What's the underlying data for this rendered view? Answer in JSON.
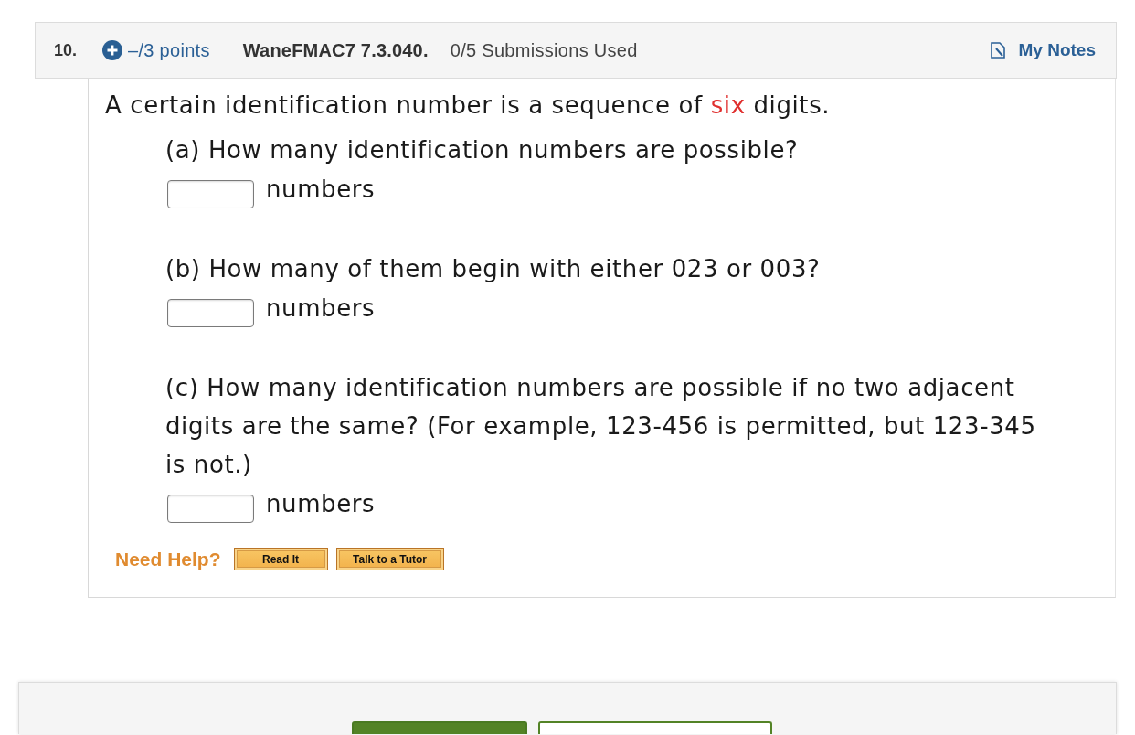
{
  "question": {
    "number": "10.",
    "points": "–/3 points",
    "source": "WaneFMAC7 7.3.040.",
    "submissions": "0/5 Submissions Used",
    "notes_link": "My Notes"
  },
  "prompt": {
    "before": "A certain identification number is a sequence of ",
    "highlight": "six",
    "after": " digits."
  },
  "parts": [
    {
      "text": "(a) How many identification numbers are possible?",
      "unit": "numbers"
    },
    {
      "text": "(b) How many of them begin with either 023 or 003?",
      "unit": "numbers"
    },
    {
      "text": "(c) How many identification numbers are possible if no two adjacent digits are the same? (For example, 123-456 is permitted, but 123-345 is not.)",
      "unit": "numbers"
    }
  ],
  "help": {
    "label": "Need Help?",
    "buttons": [
      "Read It",
      "Talk to a Tutor"
    ]
  },
  "bottom_bar": {
    "buttons": [
      {
        "kind": "filled"
      },
      {
        "kind": "outlined"
      }
    ]
  }
}
